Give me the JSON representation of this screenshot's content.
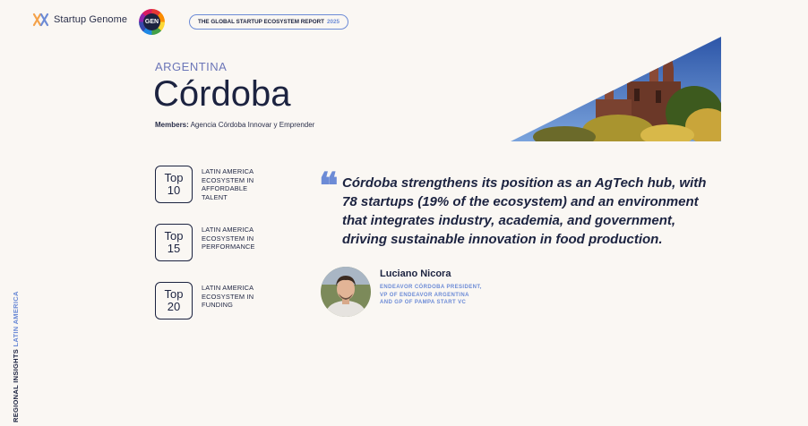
{
  "header": {
    "brand": "Startup Genome",
    "badge": "GEN",
    "report_label": "THE GLOBAL STARTUP ECOSYSTEM REPORT",
    "report_year": "2025"
  },
  "title": {
    "country": "ARGENTINA",
    "city": "Córdoba",
    "members_label": "Members:",
    "members_value": "Agencia Córdoba Innovar y Emprender"
  },
  "rankings": [
    {
      "rank_top": "Top",
      "rank_num": "10",
      "label": "LATIN AMERICA ECOSYSTEM IN AFFORDABLE TALENT"
    },
    {
      "rank_top": "Top",
      "rank_num": "15",
      "label": "LATIN AMERICA ECOSYSTEM IN PERFORMANCE"
    },
    {
      "rank_top": "Top",
      "rank_num": "20",
      "label": "LATIN AMERICA ECOSYSTEM IN FUNDING"
    }
  ],
  "quote": {
    "mark": "❝",
    "text": "Córdoba strengthens its position as an AgTech hub, with 78 startups (19% of the ecosystem) and an environment that integrates industry, academia, and government, driving sustainable innovation in food production."
  },
  "person": {
    "name": "Luciano Nicora",
    "role": "ENDEAVOR CÓRDOBA PRESIDENT, VP OF ENDEAVOR ARGENTINA AND GP OF PAMPA START VC"
  },
  "side_label": {
    "part1": "REGIONAL INSIGHTS",
    "part2": "LATIN AMERICA"
  },
  "colors": {
    "navy": "#1c2340",
    "accent": "#6c8bd6",
    "background": "#faf7f3"
  }
}
